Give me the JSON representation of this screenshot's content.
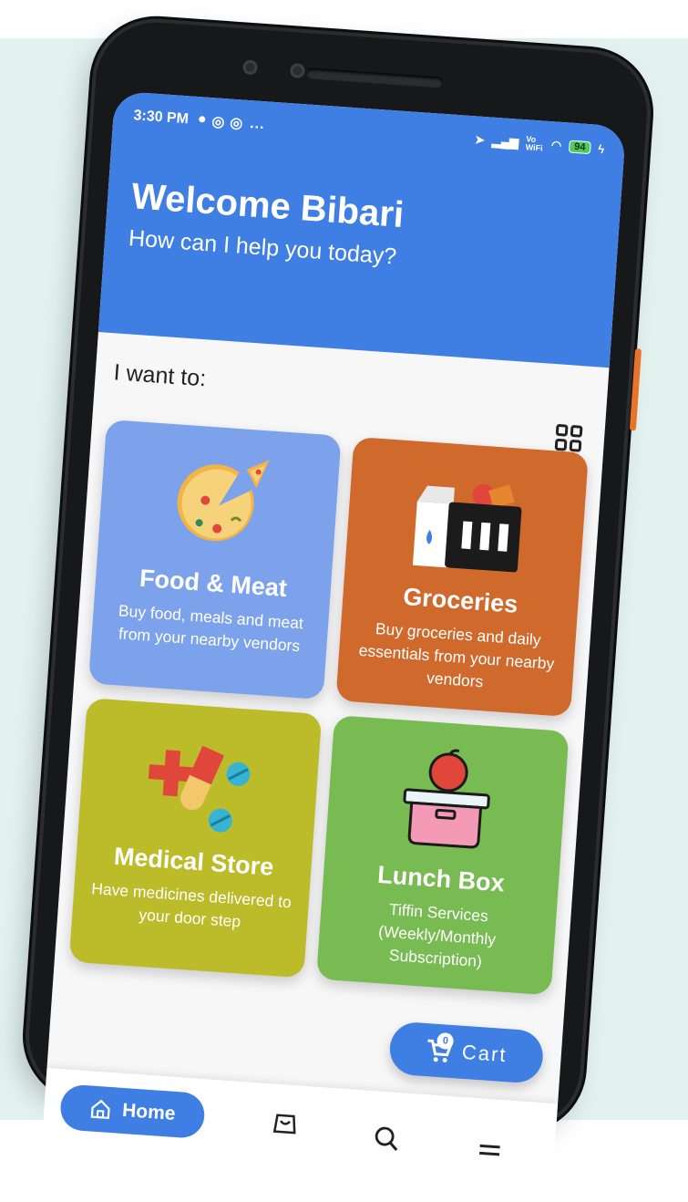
{
  "status_bar": {
    "time": "3:30 PM",
    "dots": "...",
    "network": "Vo WiFi",
    "battery": "94"
  },
  "header": {
    "welcome": "Welcome Bibari",
    "subtitle": "How can I help you today?"
  },
  "section": {
    "label": "I want to:",
    "grid_toggle_icon": "grid-view-icon"
  },
  "cards": [
    {
      "title": "Food & Meat",
      "description": "Buy food, meals and meat from your nearby vendors",
      "icon": "pizza-icon",
      "color": "#7ca2ec"
    },
    {
      "title": "Groceries",
      "description": "Buy groceries and daily essentials from your nearby vendors",
      "icon": "grocery-basket-icon",
      "color": "#d0692c"
    },
    {
      "title": "Medical Store",
      "description": "Have medicines delivered to your door step",
      "icon": "medicine-icon",
      "color": "#bcbb2a"
    },
    {
      "title": "Lunch Box",
      "description": "Tiffin Services (Weekly/Monthly Subscription)",
      "icon": "lunch-box-icon",
      "color": "#77bb52"
    }
  ],
  "cart": {
    "label": "Cart",
    "count": "0",
    "icon": "cart-icon"
  },
  "bottom_nav": {
    "home_label": "Home",
    "items": [
      "home-icon",
      "orders-bag-icon",
      "search-icon",
      "menu-icon"
    ]
  },
  "colors": {
    "primary": "#3f7ee3",
    "background": "#e3f2ef",
    "accent_button": "#e8732b"
  }
}
